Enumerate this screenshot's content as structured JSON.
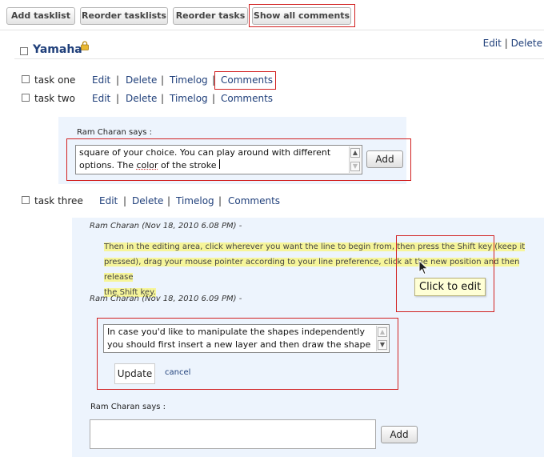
{
  "toolbar": {
    "add_tasklist": "Add tasklist",
    "reorder_tasklists": "Reorder tasklists",
    "reorder_tasks": "Reorder tasks",
    "show_all_comments": "Show all comments"
  },
  "tasklist": {
    "title": "Yamaha",
    "edit": "Edit",
    "delete": "Delete",
    "separator": "|"
  },
  "tasks": [
    {
      "name": "task one",
      "edit": "Edit",
      "delete": "Delete",
      "timelog": "Timelog",
      "comments": "Comments"
    },
    {
      "name": "task two",
      "edit": "Edit",
      "delete": "Delete",
      "timelog": "Timelog",
      "comments": "Comments"
    },
    {
      "name": "task three",
      "edit": "Edit",
      "delete": "Delete",
      "timelog": "Timelog",
      "comments": "Comments"
    }
  ],
  "comment_form_1": {
    "says": "Ram Charan says :",
    "text_line1": "square of your choice. You can play around with different",
    "text_line2_a": "options. The ",
    "text_line2_b": "color",
    "text_line2_c": " of the stroke",
    "add": "Add"
  },
  "comments": [
    {
      "meta": "Ram Charan (Nov 18, 2010 6.08 PM) -",
      "line1": "Then in the editing area, click wherever you want the line to begin from, then press the Shift key (keep it",
      "line2": "pressed), drag your mouse pointer according to your line preference, click at the new position and then release",
      "line3": "the Shift key."
    },
    {
      "meta": "Ram Charan (Nov 18, 2010 6.09 PM) -",
      "edit_line1": "In case you'd like to manipulate the shapes independently",
      "edit_line2": "you should first insert a new layer and then draw the shape",
      "update": "Update",
      "cancel": "cancel"
    }
  ],
  "tooltip": "Click to edit",
  "comment_form_2": {
    "says": "Ram Charan says :",
    "text": "",
    "add": "Add"
  },
  "colors": {
    "link": "#1f3f7a",
    "panel": "#edf4fd",
    "highlight": "#f6f59a",
    "red_outline": "#d12020"
  }
}
